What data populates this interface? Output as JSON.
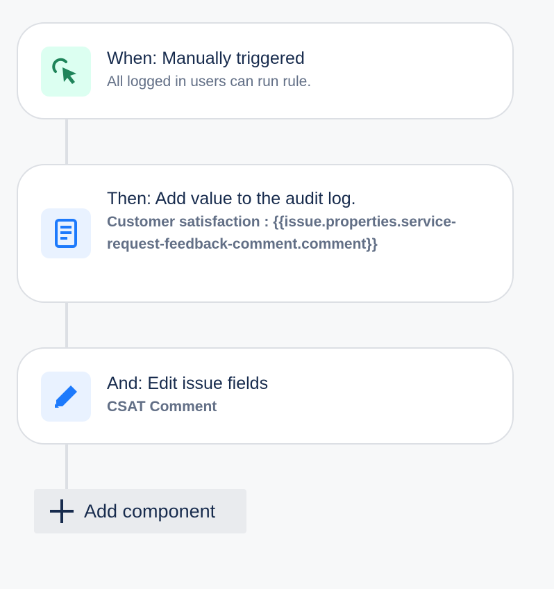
{
  "cards": [
    {
      "title": "When: Manually triggered",
      "subtitle": "All logged in users can run rule.",
      "icon": "cursor-click-icon",
      "icon_color": "#1f845a",
      "icon_bg": "#dcfff1"
    },
    {
      "title": "Then: Add value to the audit log.",
      "detail": "Customer satisfaction : {{issue.properties.service-request-feedback-comment.comment}}",
      "icon": "document-icon",
      "icon_color": "#1d7afc",
      "icon_bg": "#e9f2ff"
    },
    {
      "title": "And: Edit issue fields",
      "detail": "CSAT Comment",
      "icon": "pencil-icon",
      "icon_color": "#1d7afc",
      "icon_bg": "#e9f2ff"
    }
  ],
  "add_component": {
    "label": "Add component",
    "icon": "plus-icon"
  },
  "colors": {
    "background": "#f7f8f9",
    "card_border": "#dcdfe4",
    "title_text": "#172b4d",
    "secondary_text": "#626f86"
  }
}
